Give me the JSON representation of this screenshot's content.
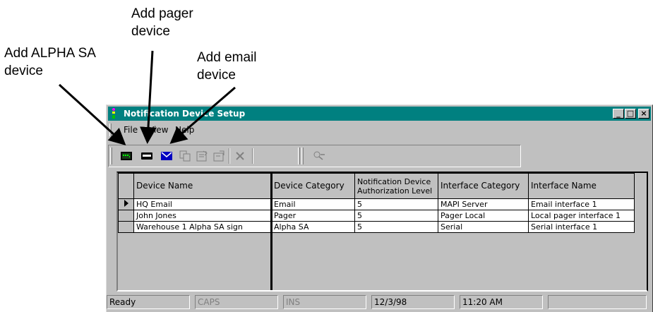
{
  "callouts": {
    "alpha": "Add ALPHA SA\ndevice",
    "pager": "Add pager\ndevice",
    "email": "Add email\ndevice"
  },
  "window": {
    "title": "Notification Device Setup",
    "minimize": "_",
    "maximize": "□",
    "close": "×"
  },
  "menu": {
    "file": "File",
    "view": "View",
    "help": "Help"
  },
  "toolbar": {
    "buttons": [
      {
        "icon": "alpha-sign-icon"
      },
      {
        "icon": "pager-icon"
      },
      {
        "icon": "envelope-icon"
      },
      {
        "icon": "copy-icon"
      },
      {
        "icon": "properties-icon"
      },
      {
        "icon": "edit-properties-icon"
      },
      {
        "icon": "delete-icon"
      },
      {
        "icon": "test-device-icon"
      }
    ]
  },
  "table": {
    "columns": [
      "Device Name",
      "Device Category",
      "Notification Device Authorization Level",
      "Interface Category",
      "Interface Name"
    ],
    "rows": [
      {
        "current": true,
        "device_name": " HQ Email",
        "device_category": "Email",
        "auth_level": "5",
        "interface_category": "MAPI Server",
        "interface_name": "Email interface 1"
      },
      {
        "current": false,
        "device_name": "John Jones",
        "device_category": "Pager",
        "auth_level": "5",
        "interface_category": "Pager Local",
        "interface_name": "Local pager interface 1"
      },
      {
        "current": false,
        "device_name": "Warehouse 1 Alpha SA sign",
        "device_category": "Alpha SA",
        "auth_level": "5",
        "interface_category": "Serial",
        "interface_name": "Serial interface 1"
      }
    ]
  },
  "status": {
    "ready": "Ready",
    "caps": "CAPS",
    "ins": "INS",
    "date": "12/3/98",
    "time": "11:20 AM"
  }
}
